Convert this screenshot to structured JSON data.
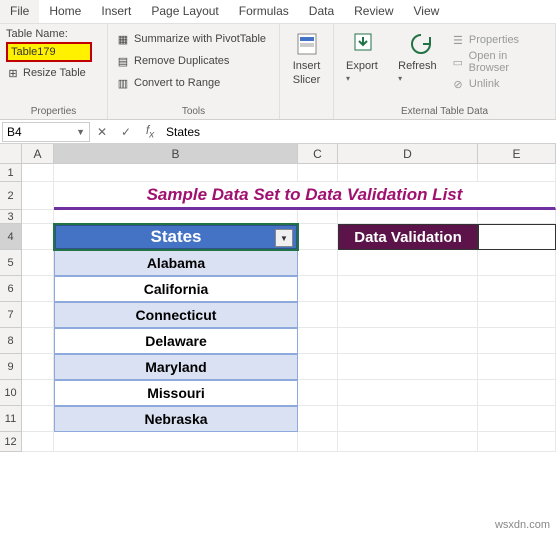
{
  "menu": {
    "file": "File",
    "home": "Home",
    "insert": "Insert",
    "pagelayout": "Page Layout",
    "formulas": "Formulas",
    "data": "Data",
    "review": "Review",
    "view": "View"
  },
  "ribbon": {
    "tableNameLabel": "Table Name:",
    "tableNameValue": "Table179",
    "resize": "Resize Table",
    "propsTitle": "Properties",
    "pivot": "Summarize with PivotTable",
    "dupes": "Remove Duplicates",
    "range": "Convert to Range",
    "toolsTitle": "Tools",
    "slicer1": "Insert",
    "slicer2": "Slicer",
    "export": "Export",
    "refresh": "Refresh",
    "extProps": "Properties",
    "extBrowser": "Open in Browser",
    "extUnlink": "Unlink",
    "extTitle": "External Table Data"
  },
  "fbar": {
    "ref": "B4",
    "formula": "States"
  },
  "cols": {
    "A": "A",
    "B": "B",
    "C": "C",
    "D": "D",
    "E": "E"
  },
  "rows": [
    "1",
    "2",
    "3",
    "4",
    "5",
    "6",
    "7",
    "8",
    "9",
    "10",
    "11",
    "12"
  ],
  "title": "Sample Data Set to Data Validation List",
  "table": {
    "header": "States",
    "data": [
      "Alabama",
      "California",
      "Connecticut",
      "Delaware",
      "Maryland",
      "Missouri",
      "Nebraska"
    ]
  },
  "dv": {
    "header": "Data Validation"
  },
  "watermark": "wsxdn.com"
}
